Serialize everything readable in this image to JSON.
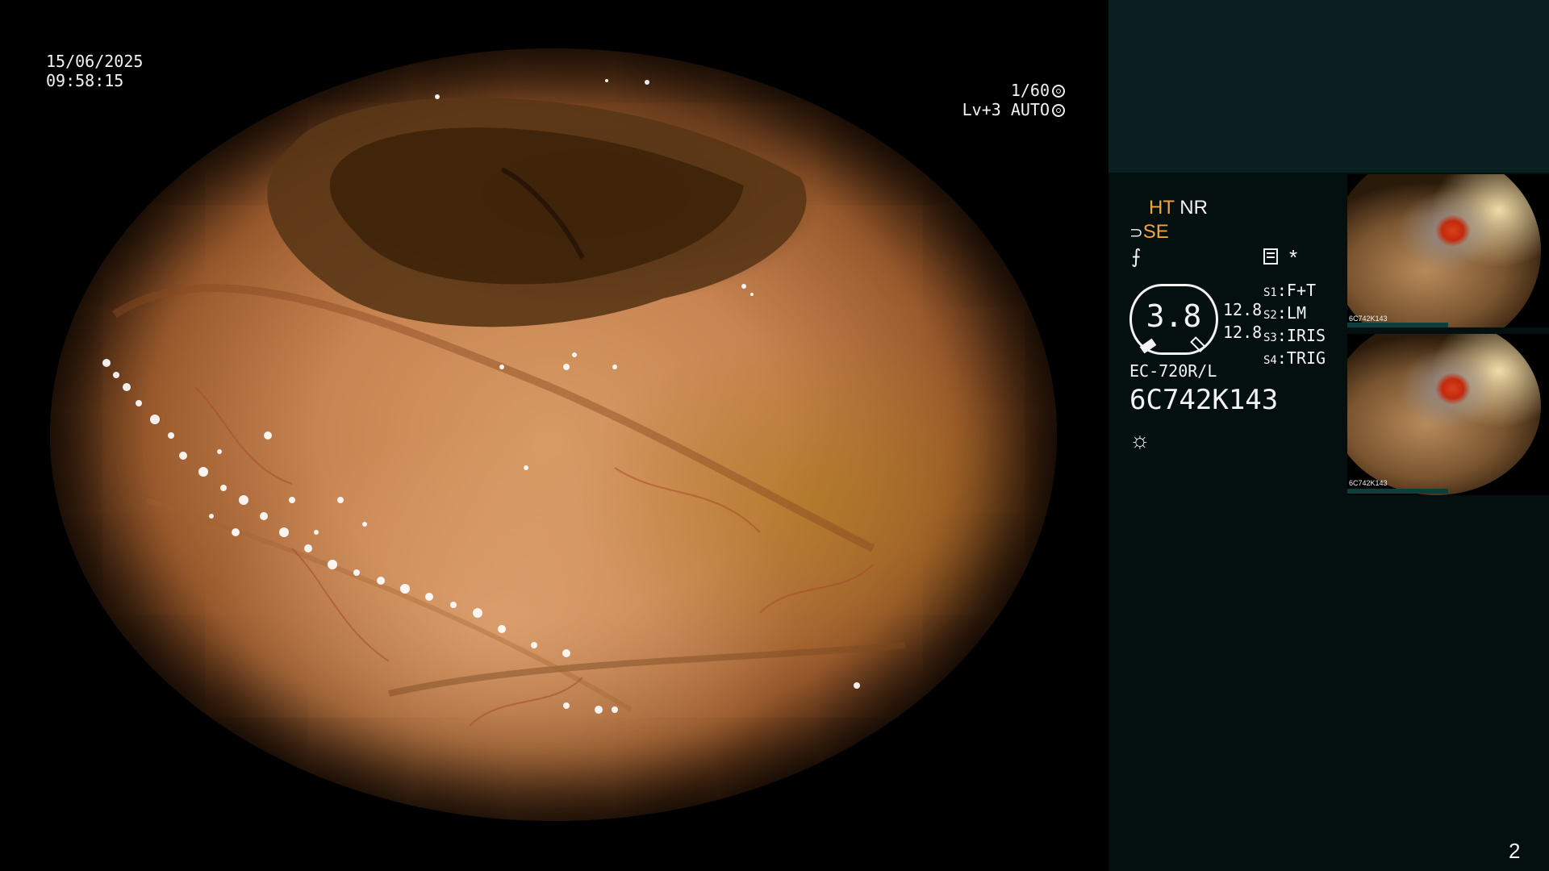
{
  "overlay": {
    "date": "15/06/2025",
    "time": "09:58:15",
    "shutter": "1/60",
    "level": "Lv+3",
    "mode": "AUTO"
  },
  "panel": {
    "ht": "HT",
    "nr": "NR",
    "se": "SE",
    "gauge_value": "3.8",
    "val_a": "12.8",
    "val_b": "12.8",
    "s_items": [
      {
        "key": "S1",
        "value": "F+T"
      },
      {
        "key": "S2",
        "value": "LM"
      },
      {
        "key": "S3",
        "value": "IRIS"
      },
      {
        "key": "S4",
        "value": "TRIG"
      }
    ],
    "scope_model": "EC-720R/L",
    "scope_serial": "6C742K143",
    "page_number": "2"
  },
  "thumbnails": [
    {
      "label": "6C742K143"
    },
    {
      "label": "6C742K143"
    }
  ],
  "colors": {
    "accent_orange": "#f2a43a",
    "panel_bg": "#04100f",
    "panel_band": "#0a1f1f"
  }
}
